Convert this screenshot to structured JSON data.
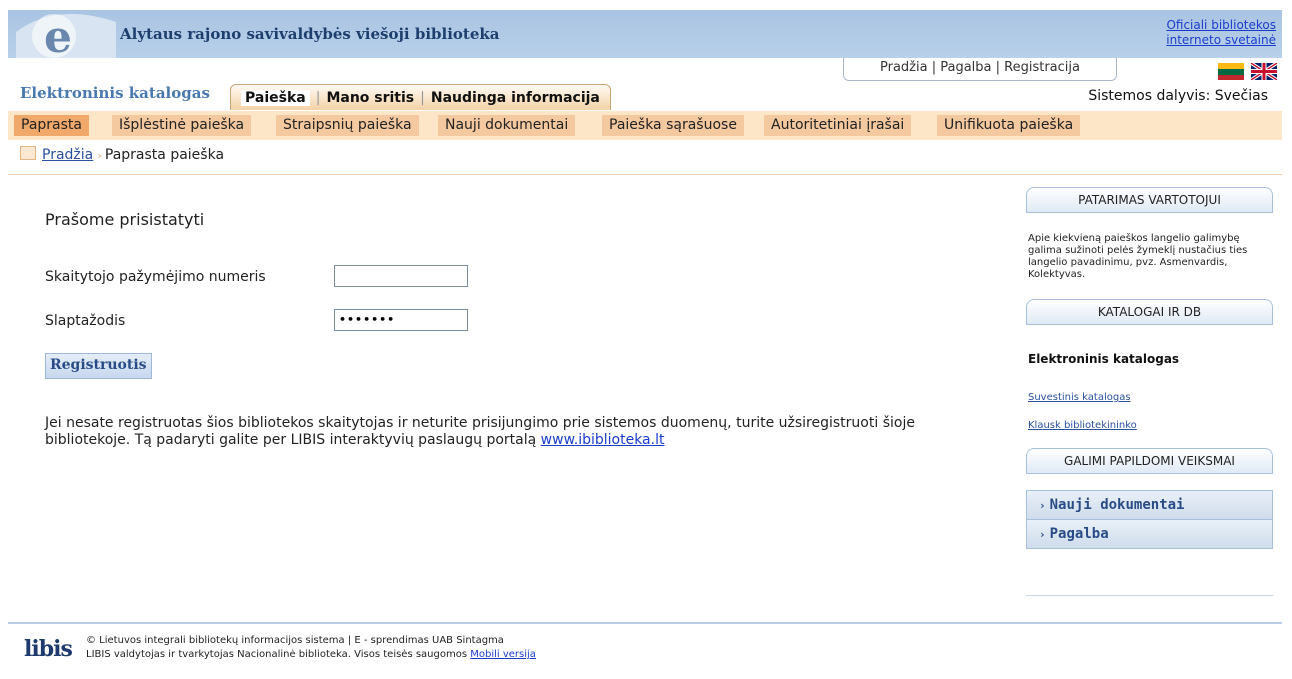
{
  "header": {
    "site_title": "Alytaus rajono savivaldybės viešoji biblioteka",
    "official_link_line1": "Oficiali bibliotekos",
    "official_link_line2": "interneto svetainė"
  },
  "util_nav": {
    "home": "Pradžia",
    "help": "Pagalba",
    "register": "Registracija"
  },
  "catalog_title": "Elektroninis katalogas",
  "main_tabs": [
    "Paieška",
    "Mano sritis",
    "Naudinga informacija"
  ],
  "participant": "Sistemos dalyvis: Svečias",
  "submenu": [
    "Paprasta",
    "Išplėstinė paieška",
    "Straipsnių paieška",
    "Nauji dokumentai",
    "Paieška sąrašuose",
    "Autoritetiniai įrašai",
    "Unifikuota paieška"
  ],
  "breadcrumb": {
    "home": "Pradžia",
    "current": "Paprasta paieška"
  },
  "login": {
    "heading": "Prašome prisistatyti",
    "card_label": "Skaitytojo pažymėjimo numeris",
    "card_value": "",
    "password_label": "Slaptažodis",
    "password_value": "•••••••",
    "submit": "Registruotis"
  },
  "info": {
    "text": "Jei nesate registruotas šios bibliotekos skaitytojas ir neturite prisijungimo prie sistemos duomenų, turite užsiregistruoti šioje bibliotekoje. Tą padaryti galite per LIBIS interaktyvių paslaugų portalą ",
    "link": "www.ibiblioteka.lt"
  },
  "sidebar": {
    "tip_title": "PATARIMAS VARTOTOJUI",
    "tip_text": "Apie kiekvieną paieškos langelio galimybę galima sužinoti pelės žymeklį nustačius ties langelio pavadinimu, pvz. Asmenvardis, Kolektyvas.",
    "catalogs_title": "KATALOGAI IR DB",
    "catalog_current": "Elektroninis katalogas",
    "catalog_links": [
      "Suvestinis katalogas",
      "Klausk bibliotekininko"
    ],
    "actions_title": "GALIMI PAPILDOMI VEIKSMAI",
    "actions": [
      "Nauji dokumentai",
      "Pagalba"
    ]
  },
  "footer": {
    "logo": "libis",
    "line1": "© Lietuvos integrali bibliotekų informacijos sistema | E - sprendimas UAB Sintagma",
    "line2": "LIBIS valdytojas ir tvarkytojas Nacionalinė biblioteka. Visos teisės saugomos ",
    "mobile_link": "Mobili versija"
  },
  "colors": {
    "accent": "#f0a96a",
    "banner": "#a9c4e2",
    "link": "#1a3ccc"
  }
}
